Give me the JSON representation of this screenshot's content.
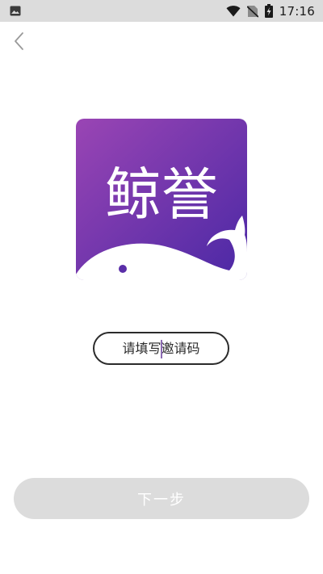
{
  "status_bar": {
    "time": "17:16",
    "icons": [
      "image-icon",
      "wifi-icon",
      "no-sim-icon",
      "battery-charging-icon"
    ]
  },
  "nav": {
    "back_icon": "chevron-left-icon"
  },
  "logo": {
    "text": "鲸誉",
    "gradient_start": "#9b44b3",
    "gradient_end": "#4d2aa6"
  },
  "invite": {
    "placeholder": "请填写邀请码",
    "value": ""
  },
  "next_button": {
    "label": "下一步",
    "background": "#dcdcdc",
    "text_color": "#ffffff"
  }
}
